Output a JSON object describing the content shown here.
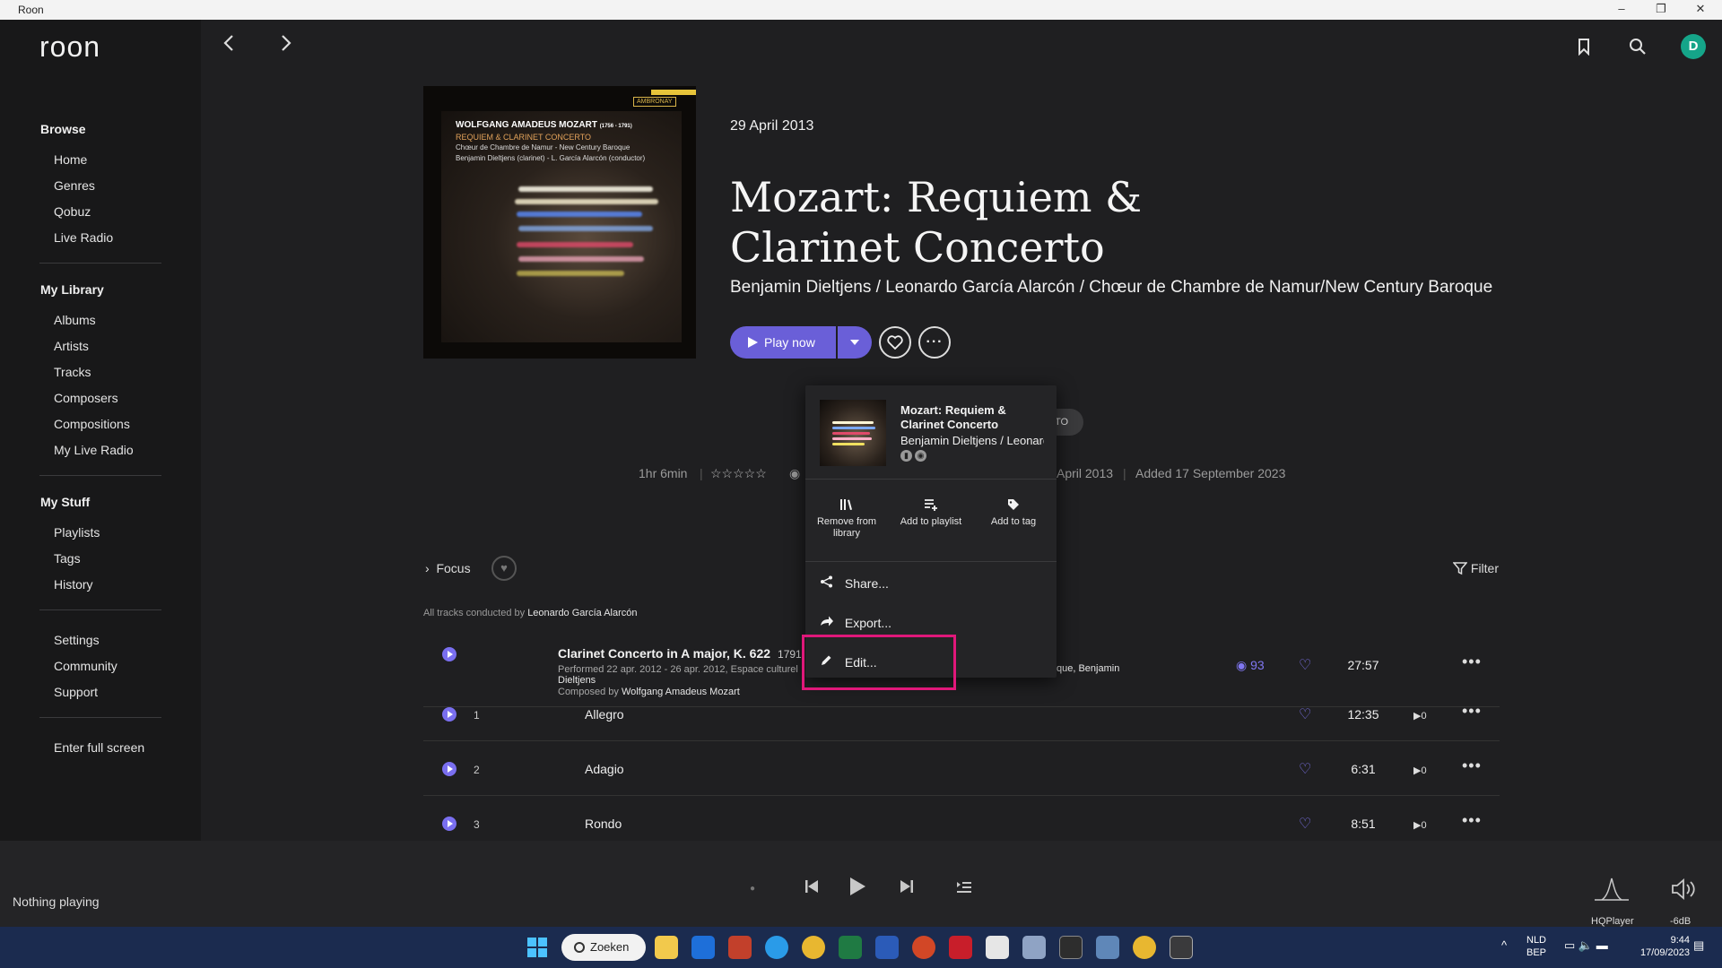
{
  "window": {
    "title": "Roon",
    "minimize": "–",
    "maximize": "❐",
    "close": "✕"
  },
  "app": {
    "logo": "roon",
    "avatar_initial": "D"
  },
  "sidebar": {
    "browse_title": "Browse",
    "browse": [
      "Home",
      "Genres",
      "Qobuz",
      "Live Radio"
    ],
    "library_title": "My Library",
    "library": [
      "Albums",
      "Artists",
      "Tracks",
      "Composers",
      "Compositions",
      "My Live Radio"
    ],
    "stuff_title": "My Stuff",
    "stuff": [
      "Playlists",
      "Tags",
      "History"
    ],
    "other": [
      "Settings",
      "Community",
      "Support"
    ],
    "fullscreen": "Enter full screen"
  },
  "cover": {
    "label": "AMBRONAY",
    "line1": "WOLFGANG AMADEUS MOZART",
    "line1_years": "(1756 - 1791)",
    "line2": "REQUIEM & CLARINET CONCERTO",
    "line3": "Chœur de Chambre de Namur - New Century Baroque",
    "line4": "Benjamin Dieltjens (clarinet) - L. García Alarcón (conductor)"
  },
  "album": {
    "date": "29 April 2013",
    "title": "Mozart: Requiem & Clarinet Concerto",
    "artists": "Benjamin Dieltjens / Leonardo García Alarcón / Chœur de Chambre de Namur/New Century Baroque",
    "play_label": "Play now",
    "duration": "1hr 6min",
    "stars": "☆☆☆☆☆",
    "released": "April 2013",
    "added": "Added 17 September 2023",
    "pill": "TO",
    "rating": 0
  },
  "tracklist": {
    "focus": "Focus",
    "filter": "Filter",
    "conducted_prefix": "All tracks conducted by",
    "conductor": "Leonardo García Alarcón",
    "work": {
      "title": "Clarinet Concerto in A major, K. 622",
      "year": "1791",
      "performed": "Performed 22 apr. 2012 - 26 apr. 2012, Espace culturel",
      "performer_tail": "que, Benjamin",
      "performer_line2": "Dieltjens",
      "composed_prefix": "Composed by",
      "composer": "Wolfgang Amadeus Mozart",
      "plays": "93",
      "duration": "27:57"
    },
    "tracks": [
      {
        "num": "1",
        "name": "Allegro",
        "duration": "12:35",
        "plays": "▶0"
      },
      {
        "num": "2",
        "name": "Adagio",
        "duration": "6:31",
        "plays": "▶0"
      },
      {
        "num": "3",
        "name": "Rondo",
        "duration": "8:51",
        "plays": "▶0"
      }
    ]
  },
  "popup": {
    "title": "Mozart: Requiem & Clarinet Concerto",
    "artist": "Benjamin Dieltjens / Leonardo García Alarcón",
    "actions": [
      {
        "label": "Remove from library",
        "icon": "library-icon"
      },
      {
        "label": "Add to playlist",
        "icon": "playlist-add-icon"
      },
      {
        "label": "Add to tag",
        "icon": "tag-icon"
      }
    ],
    "items": [
      {
        "label": "Share...",
        "icon": "share-icon"
      },
      {
        "label": "Export...",
        "icon": "export-icon"
      },
      {
        "label": "Edit...",
        "icon": "pencil-icon"
      }
    ],
    "highlight_color": "#e0187a"
  },
  "player": {
    "now_playing": "Nothing playing",
    "zone": "HQPlayer",
    "volume": "-6dB"
  },
  "taskbar": {
    "search": "Zoeken",
    "lang1": "NLD",
    "lang2": "BEP",
    "time": "9:44",
    "date": "17/09/2023"
  },
  "colors": {
    "accent": "#6a5fd8",
    "heart": "#8077f2",
    "avatar": "#15a589"
  }
}
